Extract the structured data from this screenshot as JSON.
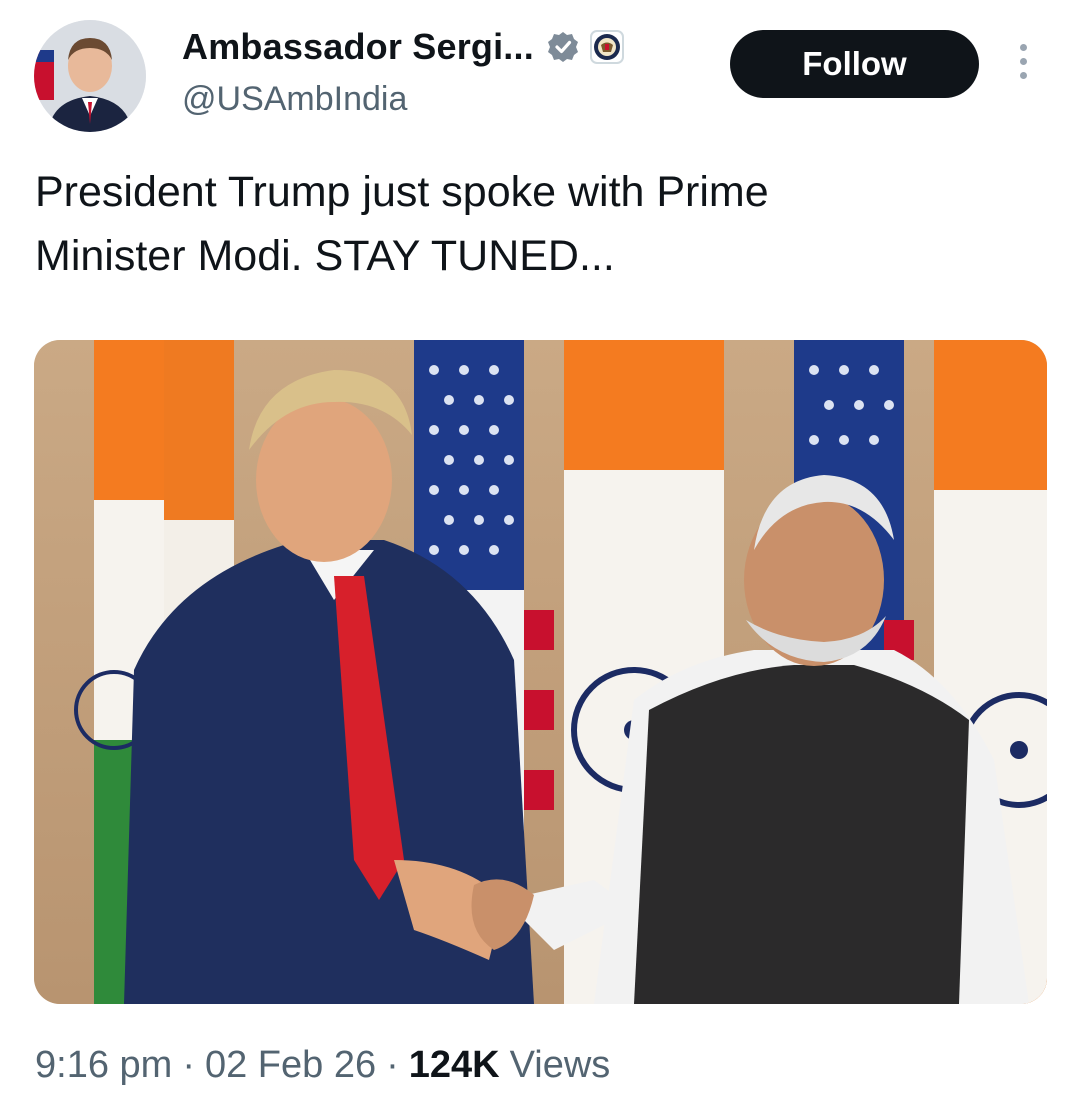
{
  "author": {
    "display_name": "Ambassador Sergi...",
    "handle": "@USAmbIndia",
    "verified_icon": "verified-badge-icon",
    "affiliation_icon": "us-state-department-seal-icon"
  },
  "actions": {
    "follow_label": "Follow",
    "more_icon": "more-options-icon"
  },
  "tweet": {
    "text": "President Trump just spoke with Prime\nMinister Modi. STAY TUNED..."
  },
  "media": {
    "type": "photo"
  },
  "meta": {
    "time": "9:16 pm",
    "separator": "·",
    "date": "02 Feb 26",
    "views_count": "124K",
    "views_label": "Views"
  },
  "colors": {
    "text_primary": "#0f1419",
    "text_secondary": "#536471",
    "button_bg": "#0f1419",
    "verified_badge": "#7e8b98"
  }
}
